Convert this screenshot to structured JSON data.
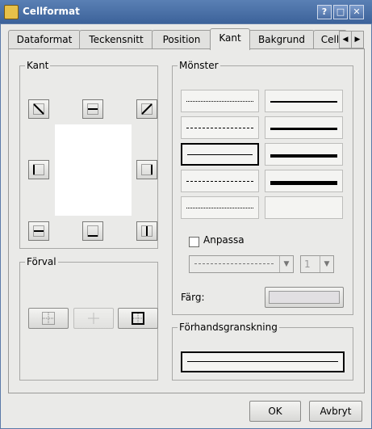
{
  "window": {
    "title": "Cellformat",
    "buttons": [
      "?",
      "□",
      "✕"
    ]
  },
  "tabs": [
    "Dataformat",
    "Teckensnitt",
    "Position",
    "Kant",
    "Bakgrund",
    "Cell"
  ],
  "tab_underlines": [
    "D",
    "T",
    "P",
    "K",
    "",
    "l"
  ],
  "active_tab": "Kant",
  "kant_group": {
    "label": "Kant"
  },
  "forval_group": {
    "label": "Förval"
  },
  "monster_group": {
    "label": "Mönster"
  },
  "anpassa": {
    "label": "Anpassa",
    "checked": false
  },
  "spin_value": "1",
  "farg": {
    "label": "Färg:",
    "color": "#e1dfe2"
  },
  "preview_group": {
    "label": "Förhandsgranskning"
  },
  "footer": {
    "ok": "OK",
    "cancel": "Avbryt"
  }
}
